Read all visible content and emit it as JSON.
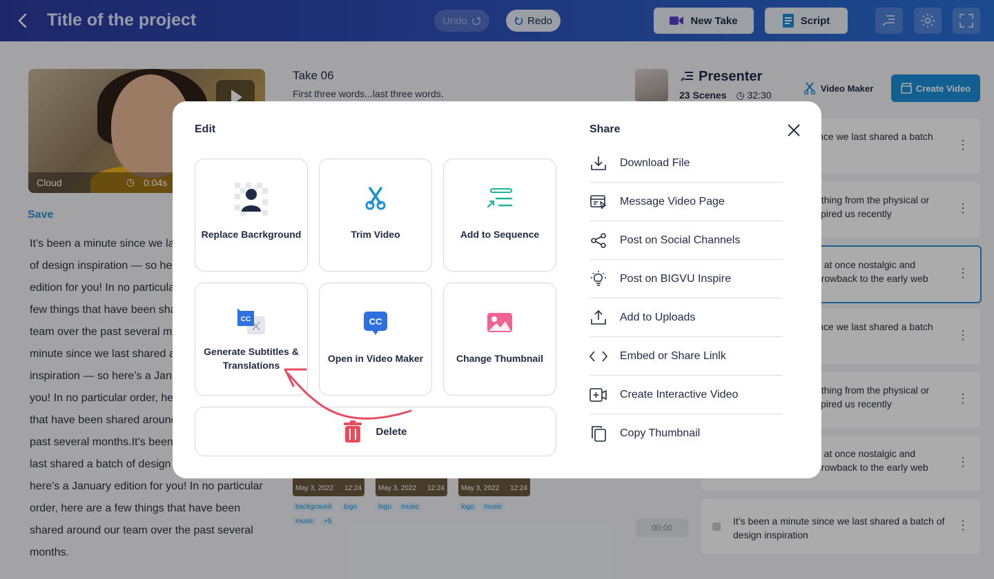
{
  "header": {
    "title": "Title of the project",
    "undo_label": "Undo",
    "redo_label": "Redo",
    "new_take_label": "New Take",
    "script_label": "Script"
  },
  "left": {
    "video_location": "Cloud",
    "video_duration": "0:04s",
    "save_label": "Save",
    "script_text": "It’s been a minute since we last shared a batch of design inspiration — so here’s a January edition for you! In no particular order, here are a few things that have been shared around our team over the past several months.It’s been a minute since we last shared a batch of design inspiration — so here’s a January edition for you! In no particular order, here are a few things that have been shared around our team over the past several months.It’s been a minute since we last shared a batch of design inspiration — so here’s a January edition for you! In no particular order, here are a few things that have been shared around our team over the past several months."
  },
  "take": {
    "title": "Take 06",
    "subtitle": "First three words...last three words.",
    "thumbs": [
      {
        "date": "May 3, 2022",
        "time": "12:24",
        "tags": [
          "background",
          "logo",
          "music",
          "+5"
        ]
      },
      {
        "date": "May 3, 2022",
        "time": "12:24",
        "tags": [
          "logo",
          "music"
        ]
      },
      {
        "date": "May 3, 2022",
        "time": "12:24",
        "tags": [
          "logo",
          "music"
        ]
      }
    ],
    "time_pill": "00:00"
  },
  "presenter": {
    "name": "Presenter",
    "scenes": "23 Scenes",
    "duration": "32:30",
    "video_maker_label": "Video Maker",
    "create_video_label": "Create Video"
  },
  "scenes": [
    {
      "text": "ince we last shared a batch\nn"
    },
    {
      "text": "ething from the physical or\nspired us recently"
    },
    {
      "text": "e at once nostalgic and\nhrowback to the early web"
    },
    {
      "text": "ince we last shared a batch\nn"
    },
    {
      "text": "ething from the physical or\nspired us recently"
    },
    {
      "text": "e at once nostalgic and\nhrowback to the early web"
    },
    {
      "text": "It’s been a minute since we last shared a batch of design inspiration"
    }
  ],
  "modal": {
    "edit_title": "Edit",
    "share_title": "Share",
    "tiles": [
      {
        "label": "Replace Bacrkground",
        "icon": "replace-background-icon"
      },
      {
        "label": "Trim Video",
        "icon": "scissors-icon"
      },
      {
        "label": "Add to Sequence",
        "icon": "sequence-icon"
      },
      {
        "label": "Generate Subtitles & Translations",
        "icon": "subtitles-translate-icon"
      },
      {
        "label": "Open in Video Maker",
        "icon": "cc-icon"
      },
      {
        "label": "Change Thumbnail",
        "icon": "image-icon"
      }
    ],
    "delete_label": "Delete",
    "share_items": [
      {
        "label": "Download File",
        "icon": "download-icon"
      },
      {
        "label": "Message Video Page",
        "icon": "message-page-icon"
      },
      {
        "label": "Post on Social Channels",
        "icon": "share-nodes-icon"
      },
      {
        "label": "Post on BIGVU Inspire",
        "icon": "lightbulb-icon"
      },
      {
        "label": "Add to Uploads",
        "icon": "upload-icon"
      },
      {
        "label": "Embed or Share Linlk",
        "icon": "code-icon"
      },
      {
        "label": "Create Interactive Video",
        "icon": "interactive-video-icon"
      },
      {
        "label": "Copy Thumbnail",
        "icon": "copy-icon"
      }
    ]
  },
  "colors": {
    "accent": "#1c8fd9",
    "teal": "#1bb39a",
    "pink": "#f06292",
    "danger": "#e94b5b",
    "annotation_arrow": "#e84a5f"
  }
}
